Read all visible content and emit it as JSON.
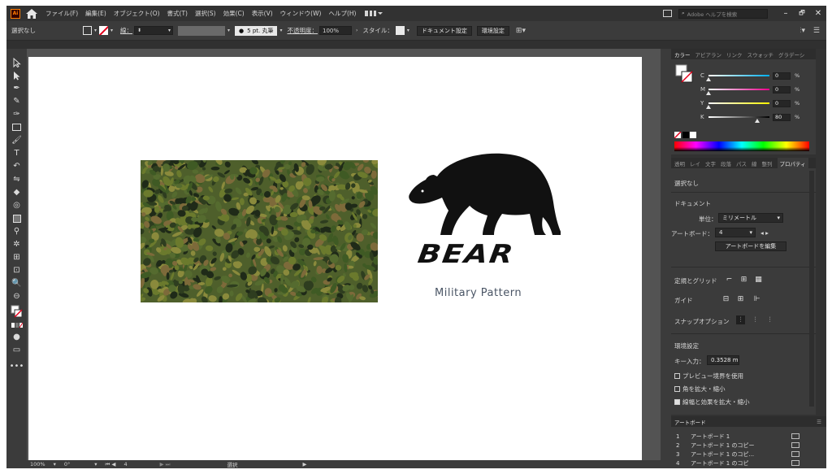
{
  "menubar": {
    "logo": "Ai",
    "items": [
      "ファイル(F)",
      "編集(E)",
      "オブジェクト(O)",
      "書式(T)",
      "選択(S)",
      "効果(C)",
      "表示(V)",
      "ウィンドウ(W)",
      "ヘルプ(H)"
    ],
    "search_placeholder": "Adobe ヘルプを検索",
    "window_buttons": [
      "–",
      "🗗",
      "✕"
    ]
  },
  "controlbar": {
    "selection": "選択なし",
    "stroke_label": "線：",
    "brush": "5 pt. 丸筆",
    "opacity_label": "不透明度：",
    "opacity_value": "100%",
    "style_label": "スタイル：",
    "doc_setup_button": "ドキュメント設定",
    "prefs_button": "環境設定"
  },
  "artboard": {
    "logo_text": "BEAR",
    "subtitle": "Military Pattern"
  },
  "color_panel": {
    "tabs": [
      "カラー",
      "アピアラン",
      "リンク",
      "スウォッチ",
      "グラデーシ"
    ],
    "channels": [
      {
        "label": "C",
        "value": "0",
        "unit": "%",
        "level": 0
      },
      {
        "label": "M",
        "value": "0",
        "unit": "%",
        "level": 0
      },
      {
        "label": "Y",
        "value": "0",
        "unit": "%",
        "level": 0
      },
      {
        "label": "K",
        "value": "80",
        "unit": "%",
        "level": 80
      }
    ]
  },
  "properties_panel": {
    "tabs": [
      "透明",
      "レイ",
      "文字",
      "段落",
      "パス",
      "線",
      "整列",
      "プロパティ"
    ],
    "no_selection": "選択なし",
    "document_heading": "ドキュメント",
    "unit_label": "単位：",
    "unit_value": "ミリメートル",
    "artboard_label": "アートボード：",
    "artboard_value": "4",
    "edit_artboard_button": "アートボードを編集",
    "rulers_label": "定規とグリッド",
    "guides_label": "ガイド",
    "snap_label": "スナップオプション",
    "prefs_heading": "環境設定",
    "key_increment_label": "キー入力：",
    "key_increment_value": "0.3528 m",
    "checkboxes": [
      {
        "label": "プレビュー境界を使用",
        "checked": false
      },
      {
        "label": "角を拡大・縮小",
        "checked": false
      },
      {
        "label": "線幅と効果を拡大・縮小",
        "checked": true
      }
    ]
  },
  "artboards_panel": {
    "title": "アートボード",
    "rows": [
      {
        "num": "1",
        "name": "アートボード 1"
      },
      {
        "num": "2",
        "name": "アートボード 1 のコピー"
      },
      {
        "num": "3",
        "name": "アートボード 1 のコピ..."
      },
      {
        "num": "4",
        "name": "アートボード 1 のコピ"
      }
    ]
  },
  "statusbar": {
    "zoom": "100%",
    "rotation": "0°",
    "artboard_num": "4",
    "tool": "選択"
  }
}
